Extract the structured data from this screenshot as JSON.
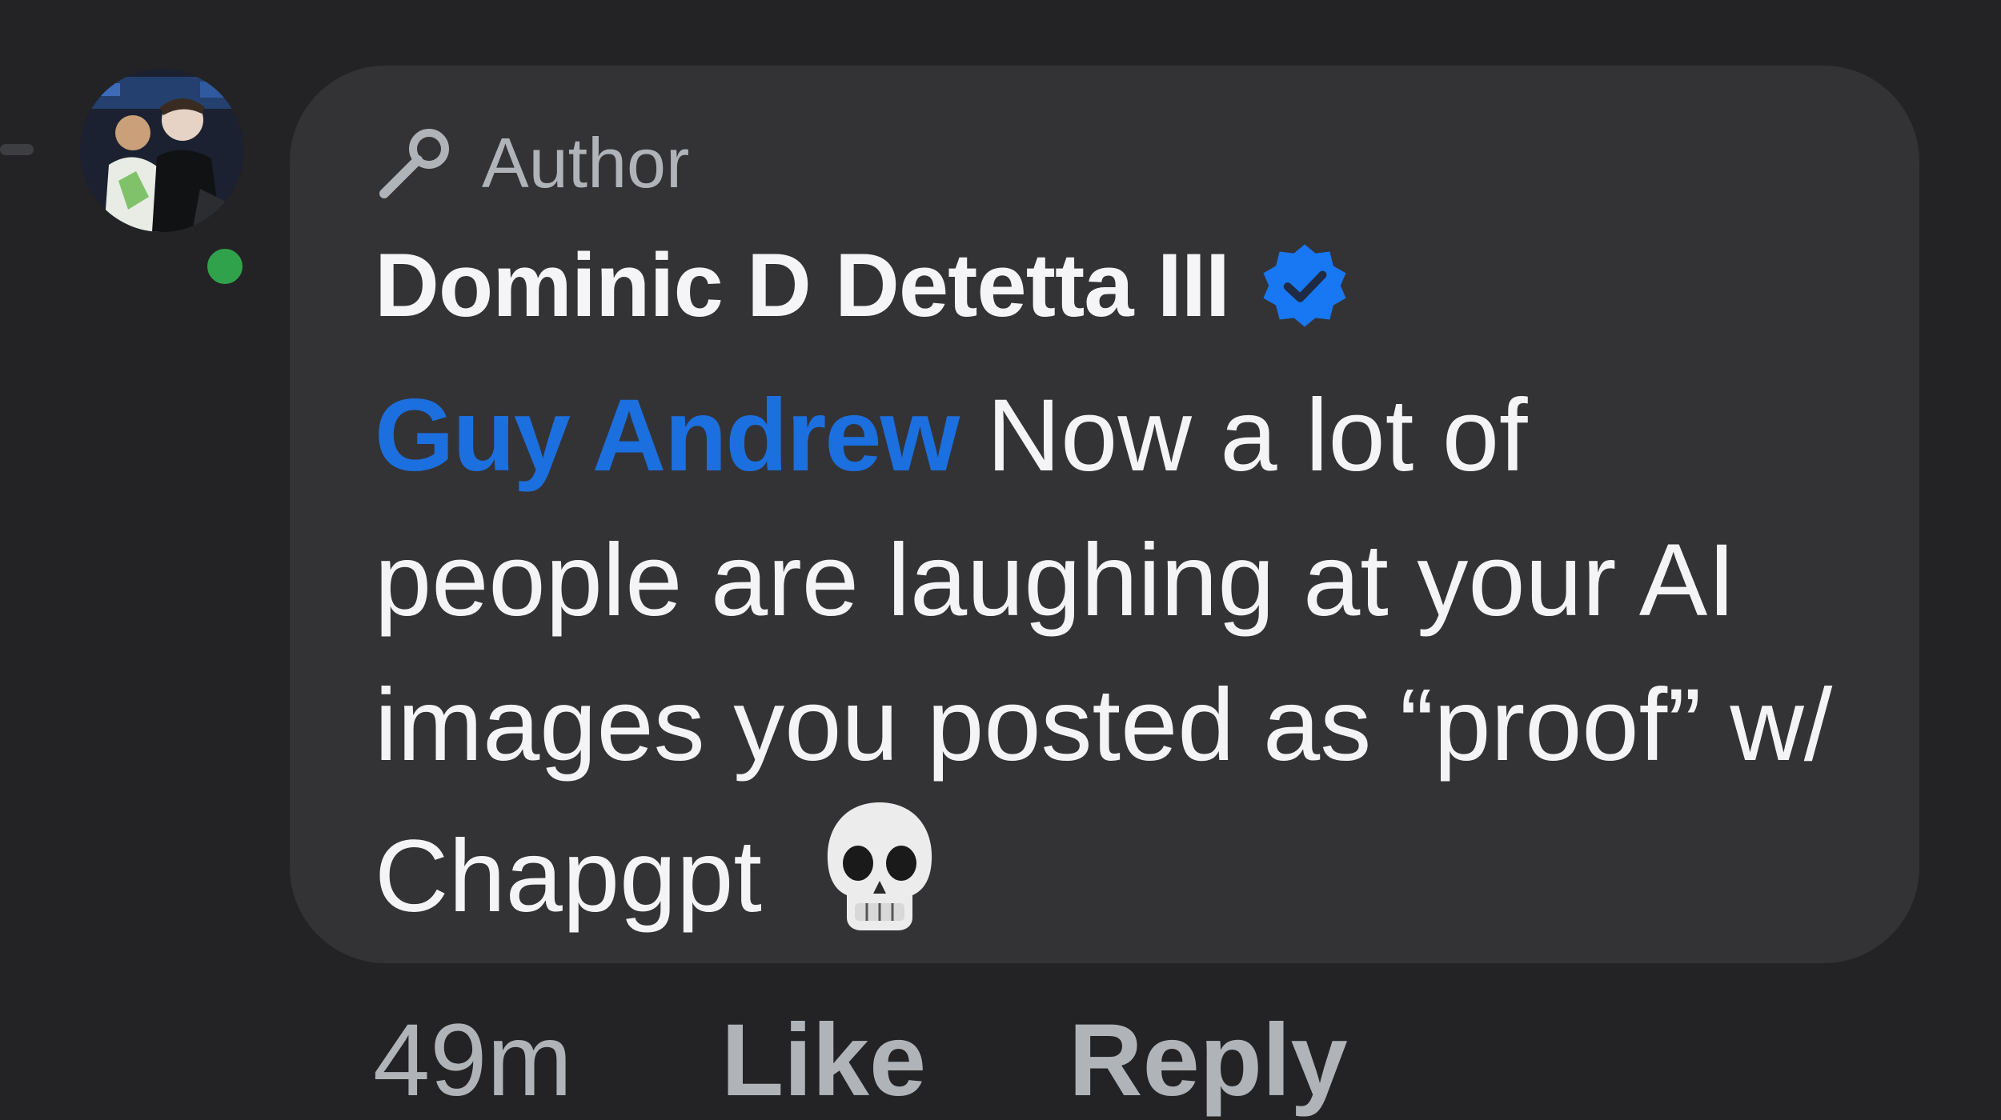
{
  "comment": {
    "badge_label": "Author",
    "badge_icon": "microphone-icon",
    "author_name": "Dominic D Detetta III",
    "verified_icon": "verified-badge-icon",
    "verified_color": "#1877f2",
    "mention": "Guy Andrew",
    "mention_color": "#1c6fde",
    "body": "Now a lot of people are laughing at your AI images you posted as “proof” w/ Chapgpt",
    "emoji_icon": "skull-emoji-icon",
    "online_status_color": "#31a24c"
  },
  "actions": {
    "timestamp": "49m",
    "like_label": "Like",
    "reply_label": "Reply"
  }
}
